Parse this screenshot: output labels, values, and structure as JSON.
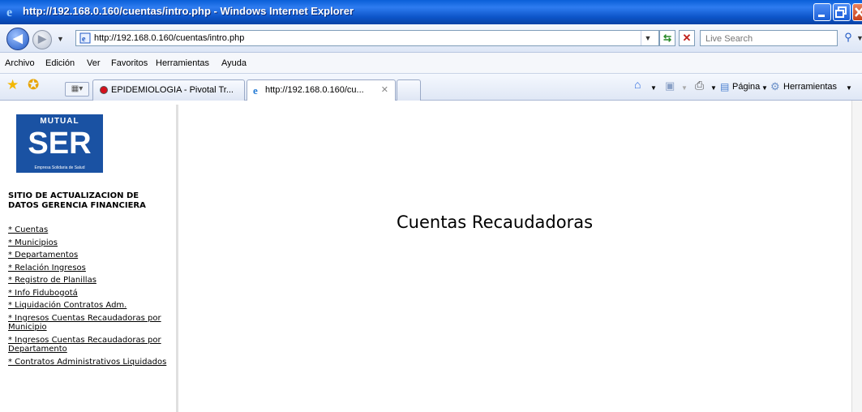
{
  "window": {
    "title": "http://192.168.0.160/cuentas/intro.php - Windows Internet Explorer"
  },
  "address": {
    "url": "http://192.168.0.160/cuentas/intro.php"
  },
  "search": {
    "placeholder": "Live Search"
  },
  "menu": [
    "Archivo",
    "Edición",
    "Ver",
    "Favoritos",
    "Herramientas",
    "Ayuda"
  ],
  "tabs": [
    {
      "label": "EPIDEMIOLOGIA - Pivotal Tr..."
    },
    {
      "label": "http://192.168.0.160/cu..."
    }
  ],
  "toolbar": {
    "page_label": "Página",
    "tools_label": "Herramientas"
  },
  "sidebar": {
    "logo_top": "MUTUAL",
    "logo_main": "SER",
    "logo_tagline": "Empresa Solidaria de Salud",
    "heading": "SITIO DE ACTUALIZACION DE DATOS GERENCIA FINANCIERA",
    "links": [
      "* Cuentas",
      "* Municipios",
      "* Departamentos",
      "* Relación Ingresos",
      "* Registro de Planillas",
      "* Info Fidubogotá",
      "* Liquidación Contratos Adm.",
      "* Ingresos Cuentas Recaudadoras por Municipio",
      "* Ingresos Cuentas Recaudadoras por Departamento",
      "* Contratos Administrativos Liquidados"
    ]
  },
  "main": {
    "title": "Cuentas Recaudadoras"
  }
}
